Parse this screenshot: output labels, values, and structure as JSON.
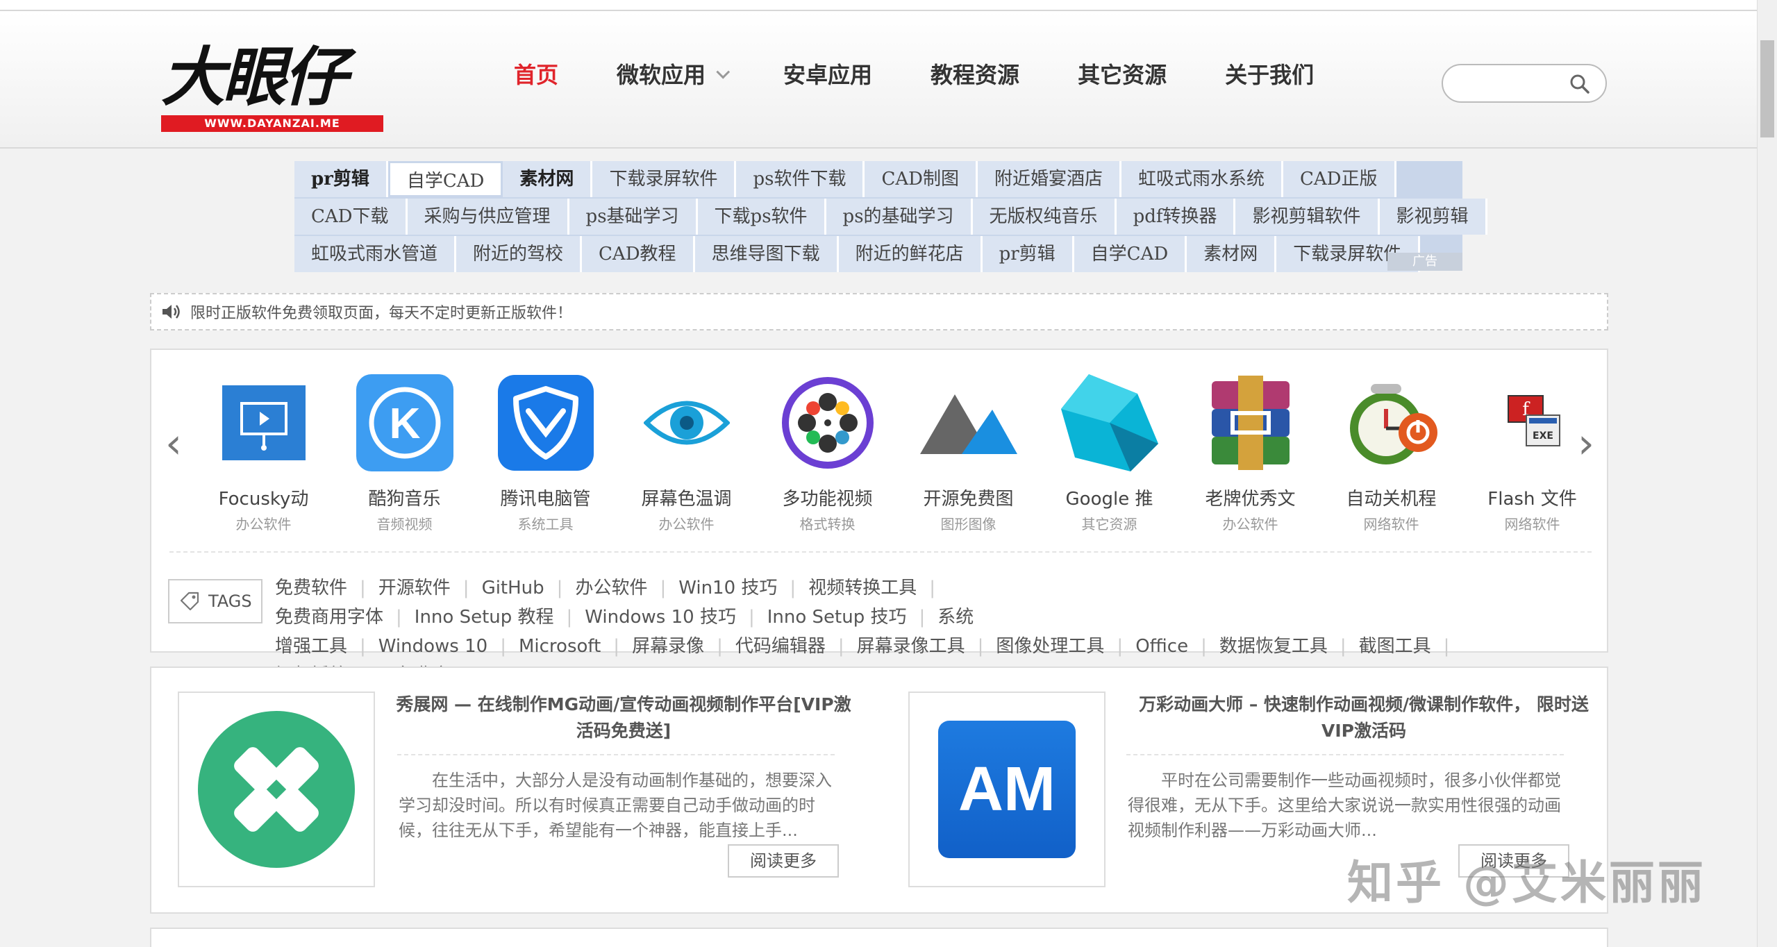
{
  "header": {
    "logo_text": "大眼仔",
    "logo_url": "WWW.DAYANZAI.ME",
    "nav": [
      {
        "label": "首页",
        "active": true
      },
      {
        "label": "微软应用",
        "dropdown": true
      },
      {
        "label": "安卓应用"
      },
      {
        "label": "教程资源"
      },
      {
        "label": "其它资源"
      },
      {
        "label": "关于我们"
      }
    ],
    "search_placeholder": ""
  },
  "keywords": {
    "row1": [
      "pr剪辑",
      "自学CAD",
      "素材网",
      "下载录屏软件",
      "ps软件下载",
      "CAD制图",
      "附近婚宴酒店",
      "虹吸式雨水系统",
      "CAD正版"
    ],
    "row2": [
      "CAD下载",
      "采购与供应管理",
      "ps基础学习",
      "下载ps软件",
      "ps的基础学习",
      "无版权纯音乐",
      "pdf转换器",
      "影视剪辑软件",
      "影视剪辑"
    ],
    "row3": [
      "虹吸式雨水管道",
      "附近的驾校",
      "CAD教程",
      "思维导图下载",
      "附近的鲜花店",
      "pr剪辑",
      "自学CAD",
      "素材网",
      "下载录屏软件"
    ]
  },
  "notice": {
    "text": "限时正版软件免费领取页面，每天不定时更新正版软件！"
  },
  "apps": [
    {
      "name": "Focusky动",
      "category": "办公软件",
      "icon": "focusky-icon"
    },
    {
      "name": "酷狗音乐",
      "category": "音频视频",
      "icon": "kugou-icon"
    },
    {
      "name": "腾讯电脑管",
      "category": "系统工具",
      "icon": "tencent-pc-manager-icon"
    },
    {
      "name": "屏幕色温调",
      "category": "办公软件",
      "icon": "eye-icon"
    },
    {
      "name": "多功能视频",
      "category": "格式转换",
      "icon": "film-reel-icon"
    },
    {
      "name": "开源免费图",
      "category": "图形图像",
      "icon": "mountain-icon"
    },
    {
      "name": "Google 推",
      "category": "其它资源",
      "icon": "dart-icon"
    },
    {
      "name": "老牌优秀文",
      "category": "办公软件",
      "icon": "winrar-icon"
    },
    {
      "name": "自动关机程",
      "category": "网络软件",
      "icon": "alarm-clock-icon"
    },
    {
      "name": "Flash 文件",
      "category": "网络软件",
      "icon": "flash-exe-icon"
    }
  ],
  "tags": {
    "label": "TAGS",
    "line1": [
      "免费软件",
      "开源软件",
      "GitHub",
      "办公软件",
      "Win10 技巧",
      "视频转换工具",
      "免费商用字体",
      "Inno Setup 教程",
      "Windows 10 技巧",
      "Inno Setup 技巧",
      "系统"
    ],
    "line2": [
      "增强工具",
      "Windows 10",
      "Microsoft",
      "屏幕录像",
      "代码编辑器",
      "屏幕录像工具",
      "图像处理工具",
      "Office",
      "数据恢复工具",
      "截图工具",
      "视频播放器",
      "免费字"
    ]
  },
  "posts": [
    {
      "title": "秀展网 — 在线制作MG动画/宣传动画视频制作平台[VIP激活码免费送]",
      "excerpt": "在生活中，大部分人是没有动画制作基础的，想要深入学习却没时间。所以有时候真正需要自己动手做动画的时候，往往无从下手，希望能有一个神器，能直接上手...",
      "read_more": "阅读更多"
    },
    {
      "title": "万彩动画大师 – 快速制作动画视频/微课制作软件， 限时送VIP激活码",
      "excerpt": "平时在公司需要制作一些动画视频时，很多小伙伴都觉得很难，无从下手。这里给大家说说一款实用性很强的动画视频制作利器——万彩动画大师...",
      "read_more": "阅读更多",
      "thumb_text": "AM"
    }
  ],
  "ad_badge": "广告",
  "watermark": "知乎 @艾米丽丽",
  "colors": {
    "accent": "#e0242b",
    "kw_bg": "#dbe4f2"
  }
}
